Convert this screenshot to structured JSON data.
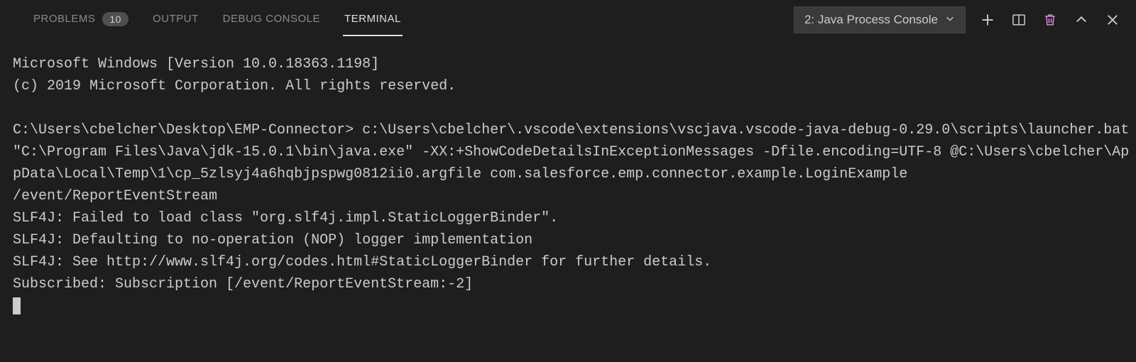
{
  "tabs": {
    "problems": "PROBLEMS",
    "problems_count": "10",
    "output": "OUTPUT",
    "debug_console": "DEBUG CONSOLE",
    "terminal": "TERMINAL"
  },
  "terminal_selector": "2: Java Process Console",
  "terminal_output": {
    "line1": "Microsoft Windows [Version 10.0.18363.1198]",
    "line2": "(c) 2019 Microsoft Corporation. All rights reserved.",
    "line3": "",
    "line4": "C:\\Users\\cbelcher\\Desktop\\EMP-Connector> c:\\Users\\cbelcher\\.vscode\\extensions\\vscjava.vscode-java-debug-0.29.0\\scripts\\launcher.bat \"C:\\Program Files\\Java\\jdk-15.0.1\\bin\\java.exe\" -XX:+ShowCodeDetailsInExceptionMessages -Dfile.encoding=UTF-8 @C:\\Users\\cbelcher\\AppData\\Local\\Temp\\1\\cp_5zlsyj4a6hqbjpspwg0812ii0.argfile com.salesforce.emp.connector.example.LoginExample                                          /event/ReportEventStream",
    "line5": "SLF4J: Failed to load class \"org.slf4j.impl.StaticLoggerBinder\".",
    "line6": "SLF4J: Defaulting to no-operation (NOP) logger implementation",
    "line7": "SLF4J: See http://www.slf4j.org/codes.html#StaticLoggerBinder for further details.",
    "line8": "Subscribed: Subscription [/event/ReportEventStream:-2]"
  }
}
